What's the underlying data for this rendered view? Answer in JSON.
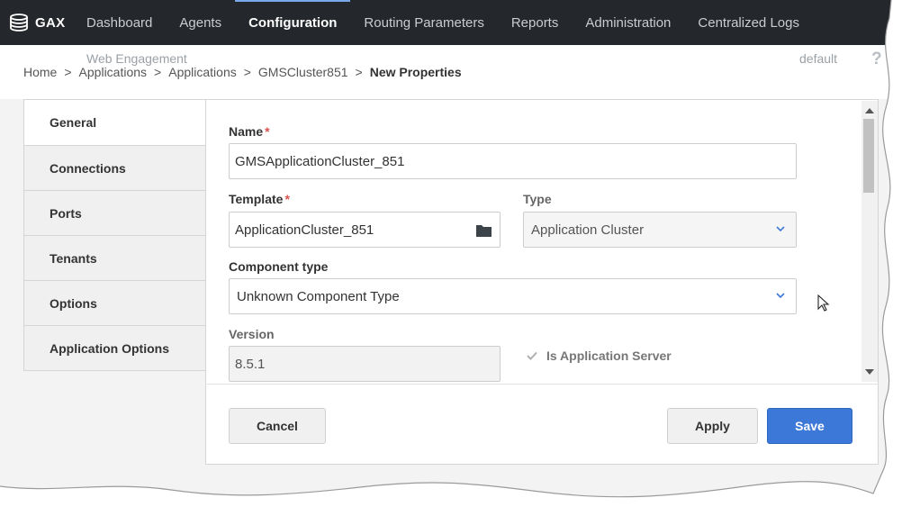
{
  "nav": {
    "brand": "GAX",
    "items": [
      {
        "label": "Dashboard",
        "active": false
      },
      {
        "label": "Agents",
        "active": false
      },
      {
        "label": "Configuration",
        "active": true
      },
      {
        "label": "Routing Parameters",
        "active": false
      },
      {
        "label": "Reports",
        "active": false
      },
      {
        "label": "Administration",
        "active": false
      },
      {
        "label": "Centralized Logs",
        "active": false
      }
    ]
  },
  "header": {
    "app_context": "Web Engagement",
    "tenant": "default",
    "help": "?",
    "breadcrumb": [
      "Home",
      "Applications",
      "Applications",
      "GMSCluster851"
    ],
    "separator": ">",
    "current": "New Properties"
  },
  "sidetabs": [
    {
      "label": "General",
      "active": true
    },
    {
      "label": "Connections",
      "active": false
    },
    {
      "label": "Ports",
      "active": false
    },
    {
      "label": "Tenants",
      "active": false
    },
    {
      "label": "Options",
      "active": false
    },
    {
      "label": "Application Options",
      "active": false
    }
  ],
  "form": {
    "name_label": "Name",
    "required_mark": "*",
    "name_value": "GMSApplicationCluster_851",
    "template_label": "Template",
    "template_value": "ApplicationCluster_851",
    "type_label": "Type",
    "type_value": "Application Cluster",
    "component_type_label": "Component type",
    "component_type_value": "Unknown Component Type",
    "version_label": "Version",
    "version_value": "8.5.1",
    "is_app_server_label": "Is Application Server",
    "is_app_server_checked": true
  },
  "footer": {
    "cancel_label": "Cancel",
    "apply_label": "Apply",
    "save_label": "Save"
  },
  "colors": {
    "nav_bg": "#24272b",
    "primary": "#3b78d8",
    "required": "#d9534f"
  }
}
